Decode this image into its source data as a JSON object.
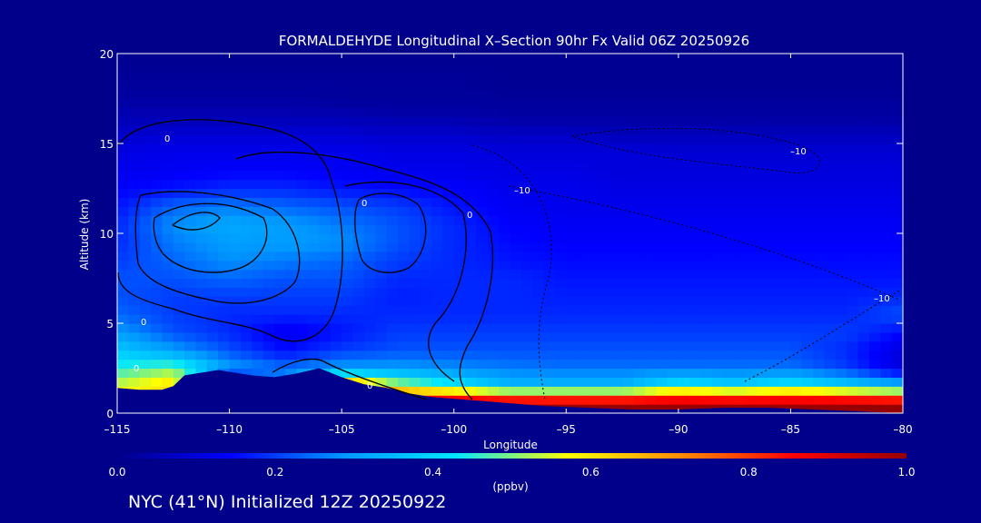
{
  "colors": {
    "background": "#00008b",
    "frame": "#ffffff",
    "text": "#ffffff",
    "contour": "#000000",
    "colorbar_stops": [
      "#00008b",
      "#0000ff",
      "#0096ff",
      "#00e6ff",
      "#ffff00",
      "#ff8c00",
      "#ff0000",
      "#960000"
    ]
  },
  "chart_data": {
    "type": "heatmap",
    "title": "FORMALDEHYDE Longitudinal X–Section 90hr  Fx Valid 06Z 20250926",
    "xlabel": "Longitude",
    "ylabel": "Altitude (km)",
    "xlim": [
      -115,
      -80
    ],
    "ylim": [
      0,
      20
    ],
    "xticks": [
      -115,
      -110,
      -105,
      -100,
      -95,
      -90,
      -85,
      -80
    ],
    "xtick_labels": [
      "–115",
      "–110",
      "–105",
      "–100",
      "–95",
      "–90",
      "–85",
      "–80"
    ],
    "yticks": [
      0,
      5,
      10,
      15,
      20
    ],
    "ytick_labels": [
      "0",
      "5",
      "10",
      "15",
      "20"
    ],
    "x": [
      -115,
      -112.5,
      -110,
      -107.5,
      -105,
      -102.5,
      -100,
      -97.5,
      -95,
      -92.5,
      -90,
      -87.5,
      -85,
      -82.5,
      -80
    ],
    "y": [
      0.5,
      1.5,
      2.5,
      3.5,
      4.5,
      5.5,
      6.5,
      7.5,
      8.5,
      9.5,
      10.5,
      11.5,
      12.5,
      13.5,
      14.5,
      15.5,
      16.5,
      17.5,
      18.5,
      19.5
    ],
    "z": [
      [
        0.6,
        0.6,
        0.0,
        0.0,
        0.9,
        0.95,
        1.0,
        1.0,
        1.0,
        1.0,
        1.0,
        1.0,
        1.0,
        1.0,
        1.0
      ],
      [
        0.55,
        0.62,
        0.0,
        0.28,
        0.75,
        0.55,
        0.45,
        0.35,
        0.35,
        0.35,
        0.45,
        0.4,
        0.45,
        0.4,
        0.35
      ],
      [
        0.45,
        0.5,
        0.3,
        0.25,
        0.3,
        0.3,
        0.28,
        0.26,
        0.25,
        0.25,
        0.25,
        0.25,
        0.25,
        0.2,
        0.1
      ],
      [
        0.38,
        0.3,
        0.22,
        0.15,
        0.2,
        0.22,
        0.22,
        0.22,
        0.22,
        0.22,
        0.22,
        0.22,
        0.22,
        0.18,
        0.1
      ],
      [
        0.3,
        0.22,
        0.18,
        0.12,
        0.16,
        0.2,
        0.2,
        0.2,
        0.2,
        0.2,
        0.2,
        0.2,
        0.2,
        0.2,
        0.15
      ],
      [
        0.24,
        0.2,
        0.18,
        0.18,
        0.18,
        0.18,
        0.18,
        0.18,
        0.18,
        0.18,
        0.18,
        0.18,
        0.18,
        0.18,
        0.22
      ],
      [
        0.22,
        0.2,
        0.2,
        0.2,
        0.2,
        0.17,
        0.18,
        0.18,
        0.17,
        0.17,
        0.17,
        0.17,
        0.17,
        0.17,
        0.18
      ],
      [
        0.22,
        0.22,
        0.24,
        0.22,
        0.22,
        0.18,
        0.18,
        0.18,
        0.16,
        0.16,
        0.16,
        0.16,
        0.16,
        0.16,
        0.16
      ],
      [
        0.2,
        0.24,
        0.28,
        0.26,
        0.24,
        0.2,
        0.18,
        0.16,
        0.15,
        0.15,
        0.15,
        0.15,
        0.15,
        0.15,
        0.15
      ],
      [
        0.18,
        0.26,
        0.3,
        0.3,
        0.28,
        0.22,
        0.18,
        0.15,
        0.14,
        0.14,
        0.14,
        0.14,
        0.14,
        0.14,
        0.14
      ],
      [
        0.18,
        0.28,
        0.32,
        0.3,
        0.26,
        0.22,
        0.18,
        0.14,
        0.13,
        0.13,
        0.13,
        0.13,
        0.13,
        0.13,
        0.13
      ],
      [
        0.16,
        0.24,
        0.26,
        0.24,
        0.22,
        0.2,
        0.16,
        0.13,
        0.12,
        0.12,
        0.12,
        0.12,
        0.12,
        0.12,
        0.12
      ],
      [
        0.14,
        0.16,
        0.18,
        0.18,
        0.16,
        0.15,
        0.14,
        0.12,
        0.12,
        0.11,
        0.11,
        0.11,
        0.11,
        0.11,
        0.11
      ],
      [
        0.12,
        0.13,
        0.14,
        0.14,
        0.13,
        0.12,
        0.12,
        0.11,
        0.11,
        0.1,
        0.1,
        0.1,
        0.1,
        0.1,
        0.1
      ],
      [
        0.11,
        0.12,
        0.12,
        0.12,
        0.12,
        0.11,
        0.11,
        0.1,
        0.1,
        0.1,
        0.09,
        0.09,
        0.09,
        0.09,
        0.09
      ],
      [
        0.08,
        0.09,
        0.09,
        0.09,
        0.09,
        0.08,
        0.08,
        0.07,
        0.07,
        0.06,
        0.06,
        0.06,
        0.06,
        0.06,
        0.06
      ],
      [
        0.05,
        0.05,
        0.05,
        0.05,
        0.05,
        0.04,
        0.04,
        0.03,
        0.03,
        0.03,
        0.03,
        0.03,
        0.03,
        0.03,
        0.03
      ],
      [
        0.03,
        0.03,
        0.03,
        0.03,
        0.02,
        0.02,
        0.02,
        0.02,
        0.02,
        0.02,
        0.02,
        0.02,
        0.02,
        0.02,
        0.02
      ],
      [
        0.02,
        0.02,
        0.02,
        0.02,
        0.02,
        0.02,
        0.02,
        0.01,
        0.01,
        0.01,
        0.01,
        0.01,
        0.01,
        0.01,
        0.01
      ],
      [
        0.01,
        0.01,
        0.01,
        0.01,
        0.01,
        0.01,
        0.01,
        0.01,
        0.01,
        0.01,
        0.01,
        0.01,
        0.01,
        0.01,
        0.01
      ]
    ],
    "terrain": {
      "x": [
        -115,
        -114,
        -113,
        -112.5,
        -112,
        -111,
        -110.5,
        -110,
        -109,
        -108,
        -107,
        -106,
        -105,
        -104,
        -103,
        -102,
        -101,
        -100,
        -98,
        -96,
        -94,
        -92,
        -90,
        -88,
        -86,
        -84,
        -82,
        -80
      ],
      "y": [
        1.4,
        1.3,
        1.3,
        1.5,
        2.1,
        2.3,
        2.4,
        2.3,
        2.1,
        2.0,
        2.2,
        2.5,
        2.0,
        1.6,
        1.4,
        1.1,
        0.9,
        0.8,
        0.6,
        0.4,
        0.3,
        0.2,
        0.2,
        0.3,
        0.3,
        0.2,
        0.1,
        0.0
      ]
    },
    "contour_labels": [
      "0",
      "0",
      "0",
      "0",
      "0",
      "0",
      "–10",
      "–10",
      "–10"
    ],
    "colorbar": {
      "min": 0.0,
      "max": 1.0,
      "ticks": [
        "0.0",
        "0.2",
        "0.4",
        "0.6",
        "0.8",
        "1.0"
      ],
      "unit": "(ppbv)"
    }
  },
  "footer": "NYC (41°N) Initialized 12Z 20250922"
}
